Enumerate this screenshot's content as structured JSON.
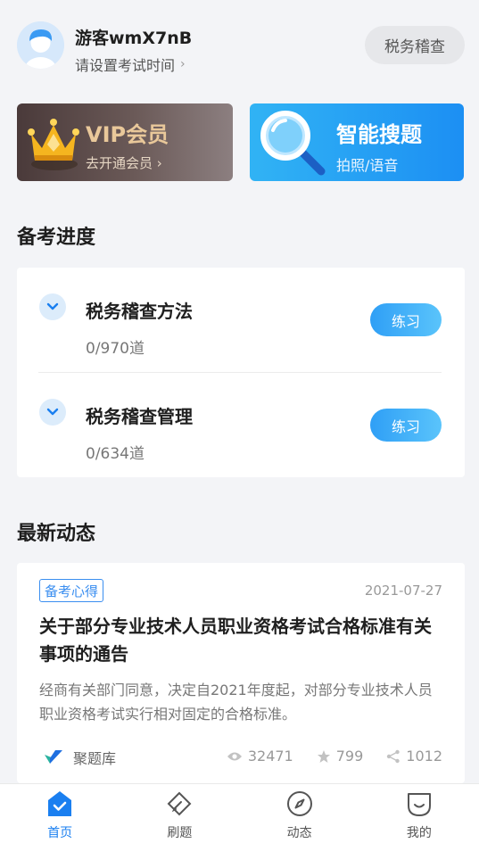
{
  "user": {
    "username": "游客wmX7nB",
    "exam_time_hint": "请设置考试时间"
  },
  "subject_button": "税务稽查",
  "vip": {
    "title": "VIP会员",
    "subtitle": "去开通会员"
  },
  "smart_search": {
    "title": "智能搜题",
    "subtitle": "拍照/语音"
  },
  "progress": {
    "title": "备考进度",
    "courses": [
      {
        "name": "税务稽查方法",
        "count": "0/970道",
        "action": "练习"
      },
      {
        "name": "税务稽查管理",
        "count": "0/634道",
        "action": "练习"
      }
    ]
  },
  "news": {
    "title": "最新动态",
    "item": {
      "tag": "备考心得",
      "date": "2021-07-27",
      "headline": "关于部分专业技术人员职业资格考试合格标准有关事项的通告",
      "summary": "经商有关部门同意，决定自2021年度起，对部分专业技术人员职业资格考试实行相对固定的合格标准。",
      "source": "聚题库",
      "views": "32471",
      "stars": "799",
      "shares": "1012"
    }
  },
  "bottom_nav": [
    {
      "label": "首页",
      "icon": "home-icon",
      "active": true
    },
    {
      "label": "刷题",
      "icon": "pen-icon",
      "active": false
    },
    {
      "label": "动态",
      "icon": "compass-icon",
      "active": false
    },
    {
      "label": "我的",
      "icon": "profile-icon",
      "active": false
    }
  ],
  "colors": {
    "accent": "#1a7ff0",
    "background": "#f3f4f7",
    "vip_gold": "#e9c89a",
    "practice_button": "#2f9ff6"
  }
}
